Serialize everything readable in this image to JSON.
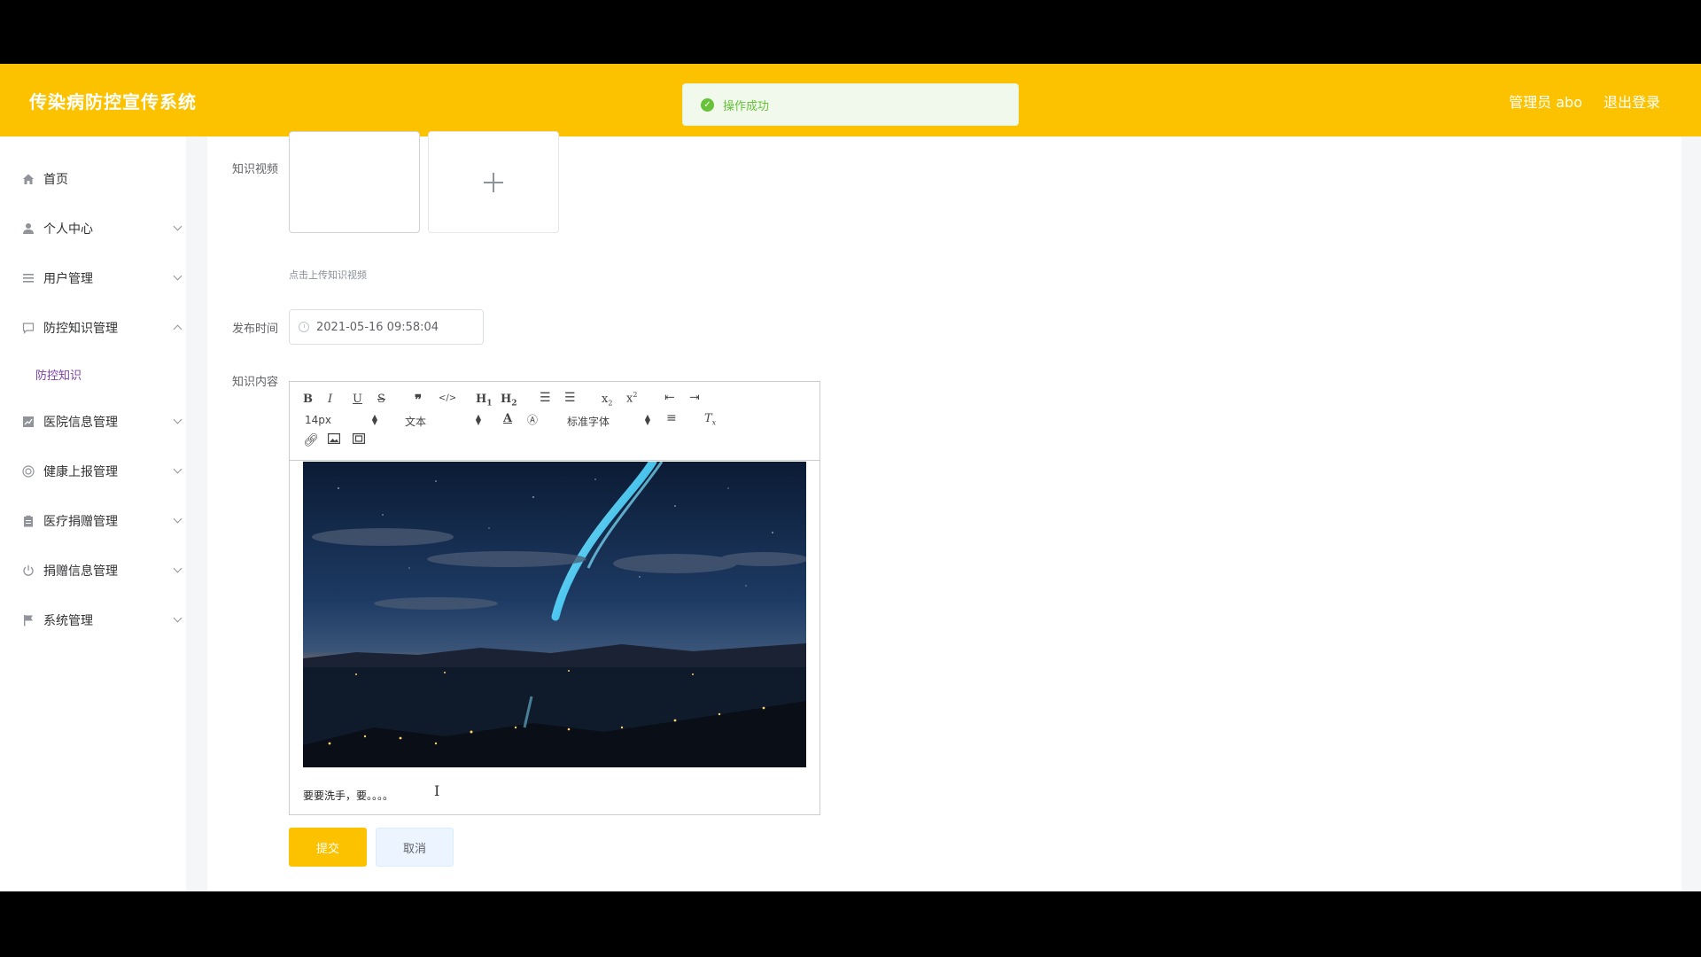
{
  "header": {
    "title": "传染病防控宣传系统",
    "user_label": "管理员 abo",
    "logout_label": "退出登录"
  },
  "toast": {
    "message": "操作成功",
    "icon": "check-circle-icon",
    "color": "#67C23A"
  },
  "sidebar": {
    "items": [
      {
        "label": "首页",
        "icon": "home-icon"
      },
      {
        "label": "个人中心",
        "icon": "user-icon"
      },
      {
        "label": "用户管理",
        "icon": "list-icon"
      },
      {
        "label": "防控知识管理",
        "icon": "chat-icon"
      },
      {
        "label": "医院信息管理",
        "icon": "chart-icon"
      },
      {
        "label": "健康上报管理",
        "icon": "target-icon"
      },
      {
        "label": "医疗捐赠管理",
        "icon": "clipboard-icon"
      },
      {
        "label": "捐赠信息管理",
        "icon": "power-icon"
      },
      {
        "label": "系统管理",
        "icon": "flag-icon"
      }
    ],
    "active_sub": "防控知识"
  },
  "form": {
    "video_label": "知识视频",
    "video_hint": "点击上传知识视频",
    "publish_time_label": "发布时间",
    "publish_time_value": "2021-05-16 09:58:04",
    "content_label": "知识内容",
    "editor": {
      "font_size": "14px",
      "heading": "文本",
      "font_family": "标准字体",
      "body_text": "要要洗手，要。。。。"
    },
    "submit_label": "提交",
    "cancel_label": "取消"
  },
  "colors": {
    "brand": "#FCC200",
    "active_submenu": "#7B3FA6"
  }
}
